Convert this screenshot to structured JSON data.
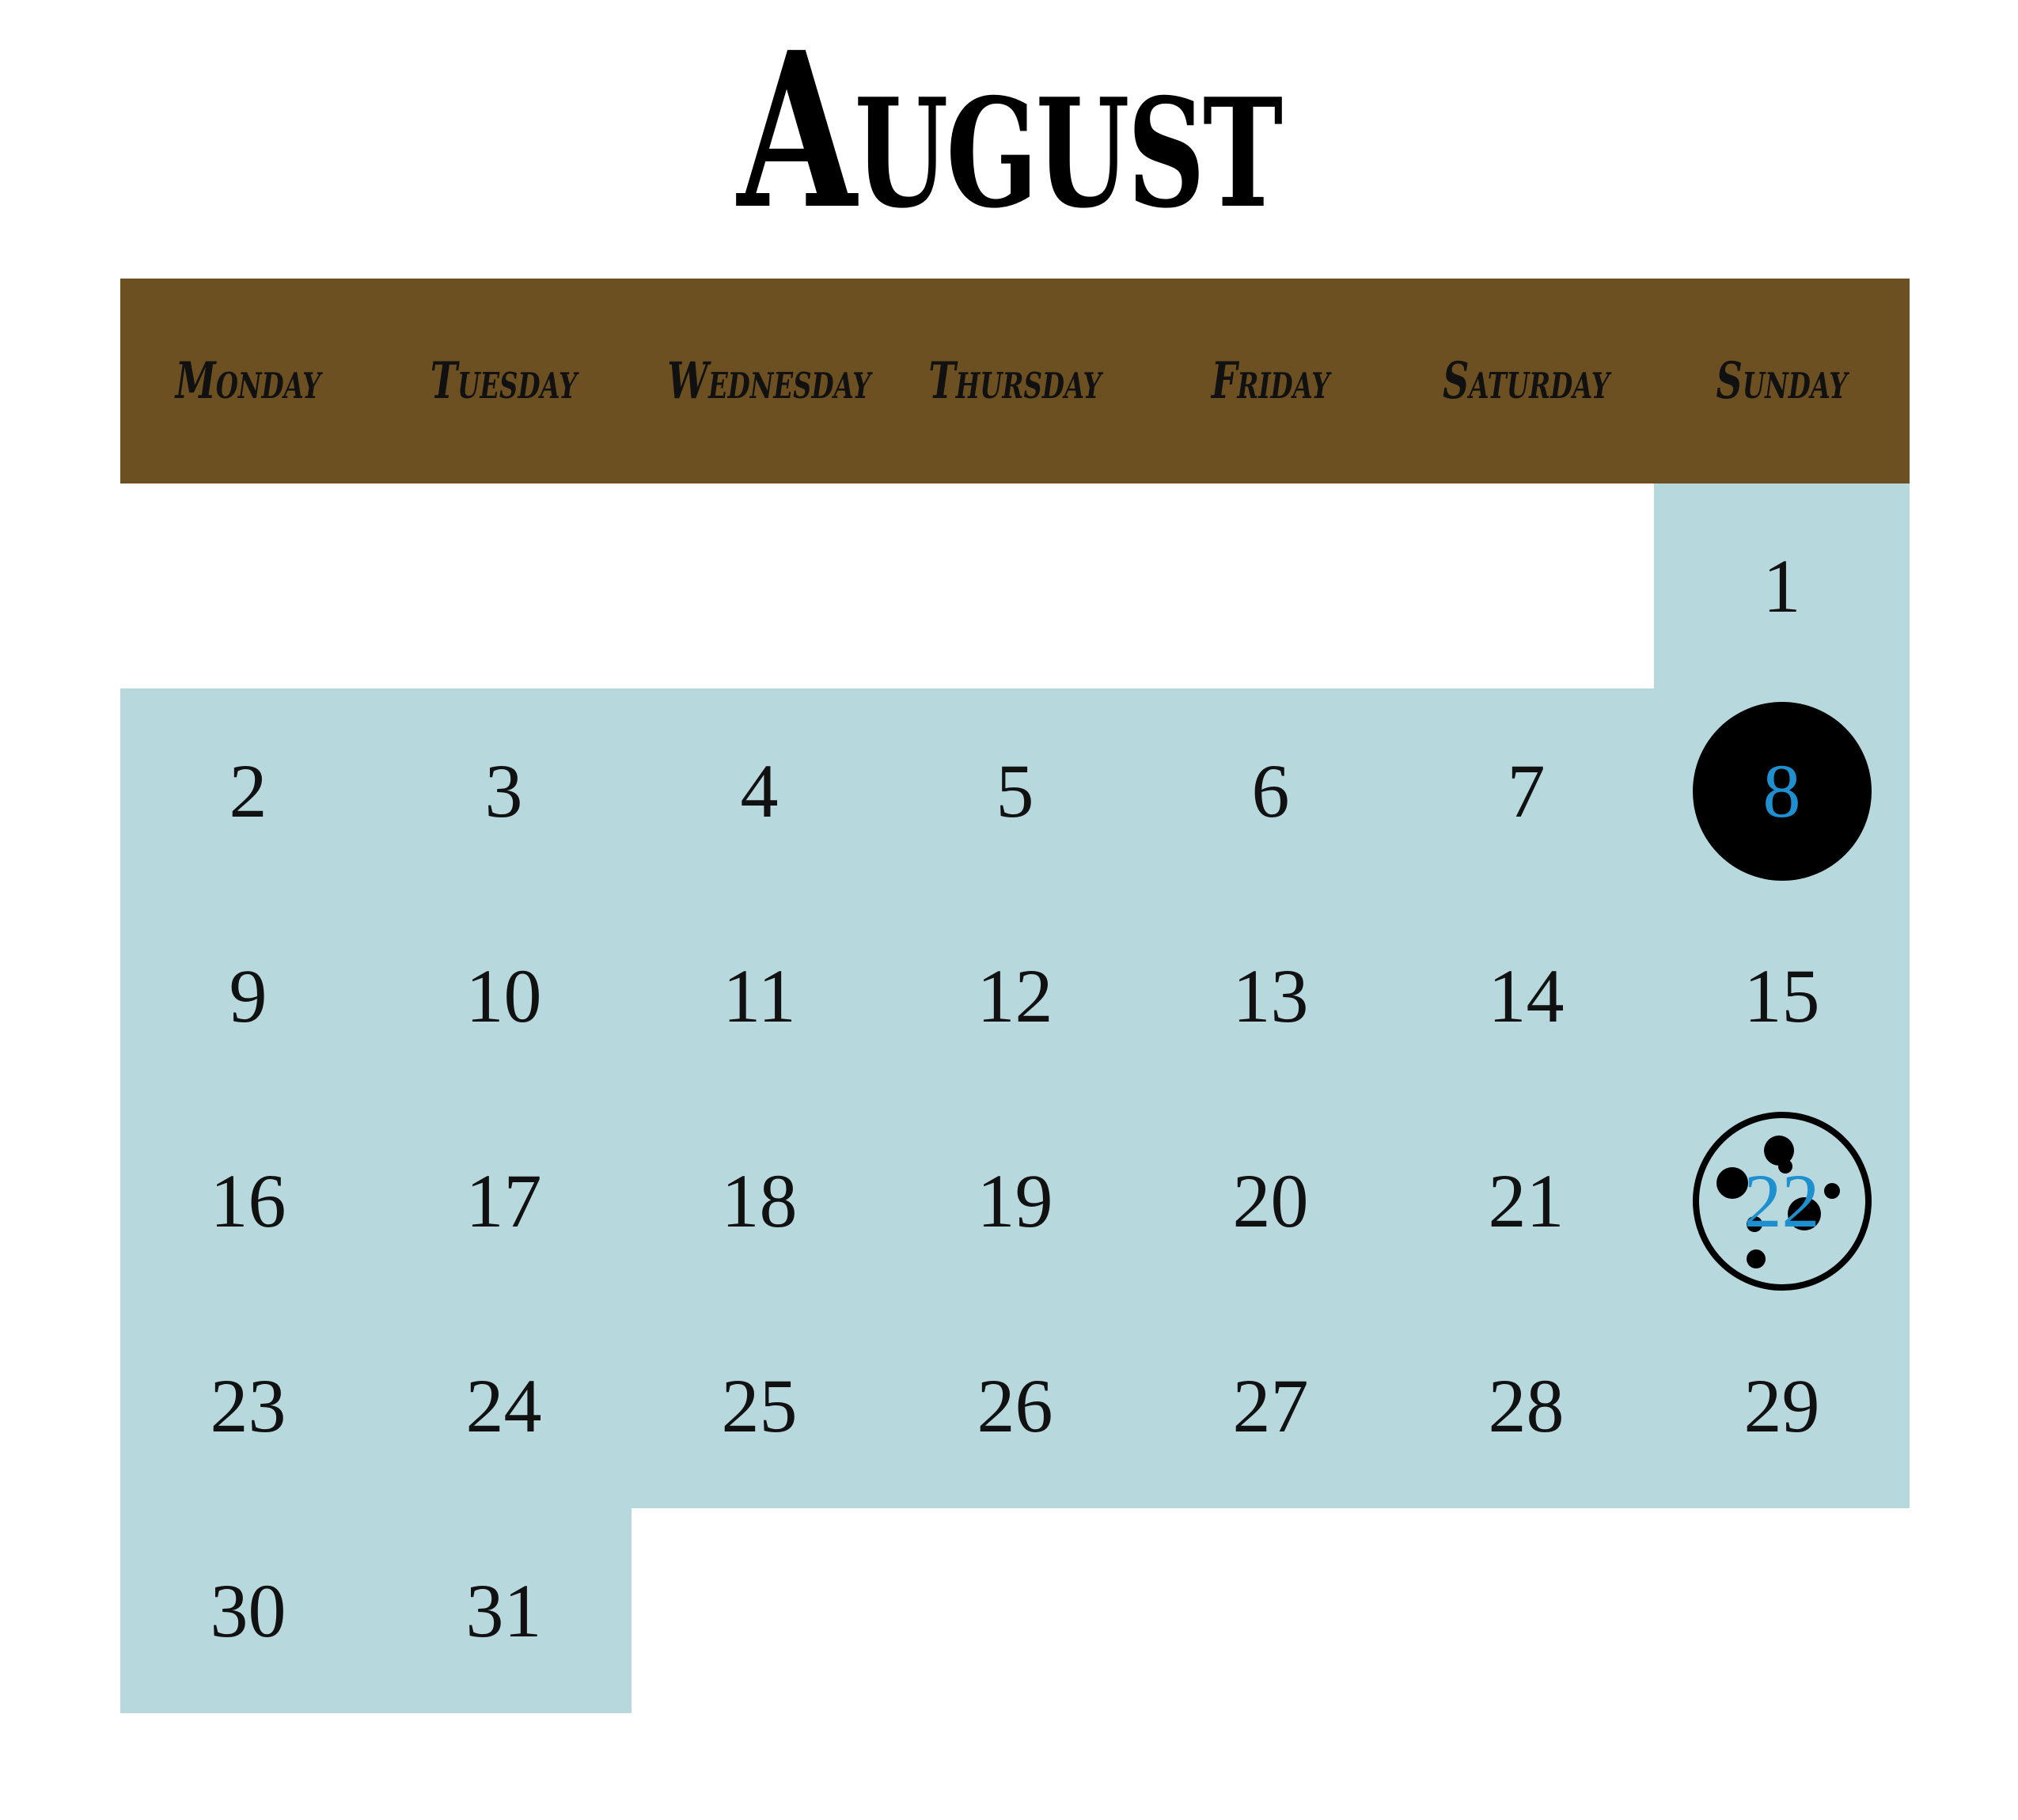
{
  "title": "August",
  "colors": {
    "header_bg": "#6c5022",
    "cell_bg": "#b7d8dd",
    "highlight_text": "#1e90d0",
    "text": "#111111"
  },
  "weekdays": [
    "Monday",
    "Tuesday",
    "Wednesday",
    "Thursday",
    "Friday",
    "Saturday",
    "Sunday"
  ],
  "weeks": [
    [
      null,
      null,
      null,
      null,
      null,
      null,
      "1"
    ],
    [
      "2",
      "3",
      "4",
      "5",
      "6",
      "7",
      "8"
    ],
    [
      "9",
      "10",
      "11",
      "12",
      "13",
      "14",
      "15"
    ],
    [
      "16",
      "17",
      "18",
      "19",
      "20",
      "21",
      "22"
    ],
    [
      "23",
      "24",
      "25",
      "26",
      "27",
      "28",
      "29"
    ],
    [
      "30",
      "31",
      null,
      null,
      null,
      null,
      null
    ]
  ],
  "moon_markers": [
    {
      "day": "8",
      "icon": "new-moon-icon"
    },
    {
      "day": "22",
      "icon": "full-moon-icon"
    }
  ]
}
